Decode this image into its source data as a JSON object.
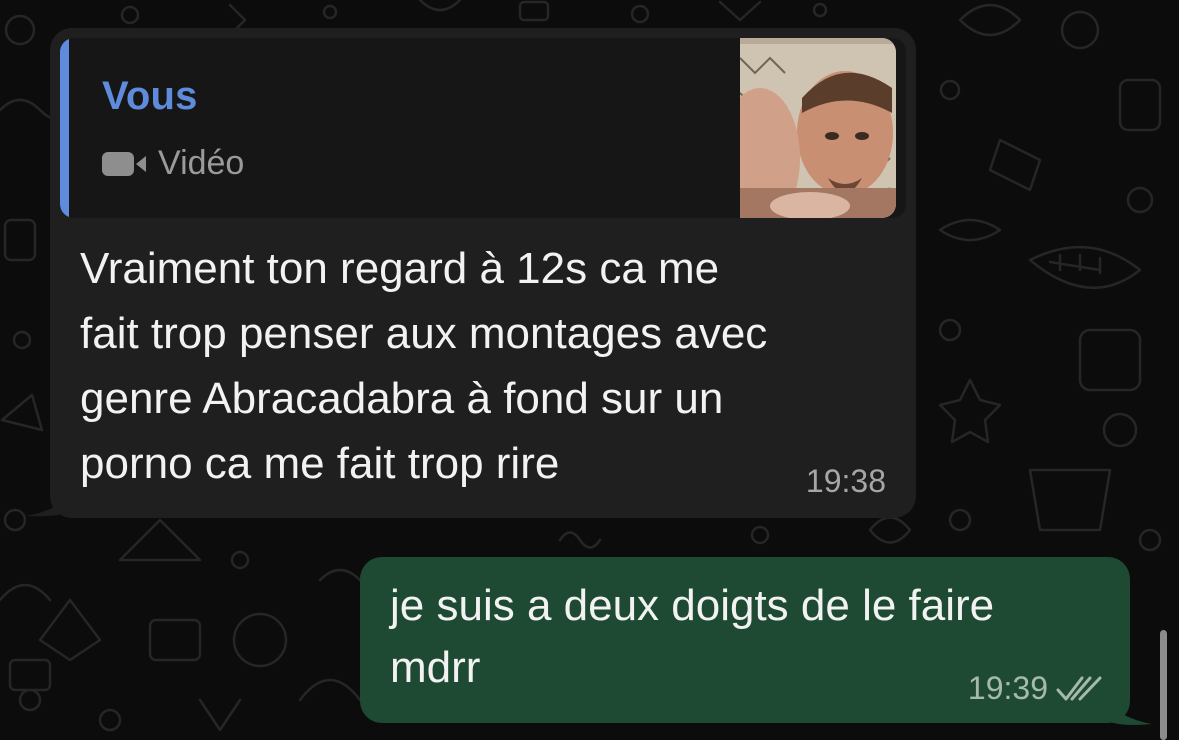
{
  "chat": {
    "messages": [
      {
        "direction": "incoming",
        "reply_to": {
          "author": "Vous",
          "kind_icon": "video-camera-icon",
          "kind_label": "Vidéo",
          "has_thumbnail": true
        },
        "lines": [
          "Vraiment ton regard à 12s ca me",
          "fait trop penser aux montages avec",
          "genre Abracadabra à fond sur un",
          "porno ca me fait trop rire"
        ],
        "time": "19:38"
      },
      {
        "direction": "outgoing",
        "lines": [
          "je suis a deux doigts de le faire",
          "mdrr"
        ],
        "time": "19:39",
        "status_icon": "double-check-icon"
      }
    ]
  },
  "colors": {
    "background": "#0c0c0c",
    "incoming_bubble": "#1f1f1f",
    "reply_panel": "#161616",
    "reply_accent": "#5f8bdc",
    "outgoing_bubble": "#1e4a33",
    "text": "#f2f2f2",
    "time_text": "#a6a6a6"
  }
}
